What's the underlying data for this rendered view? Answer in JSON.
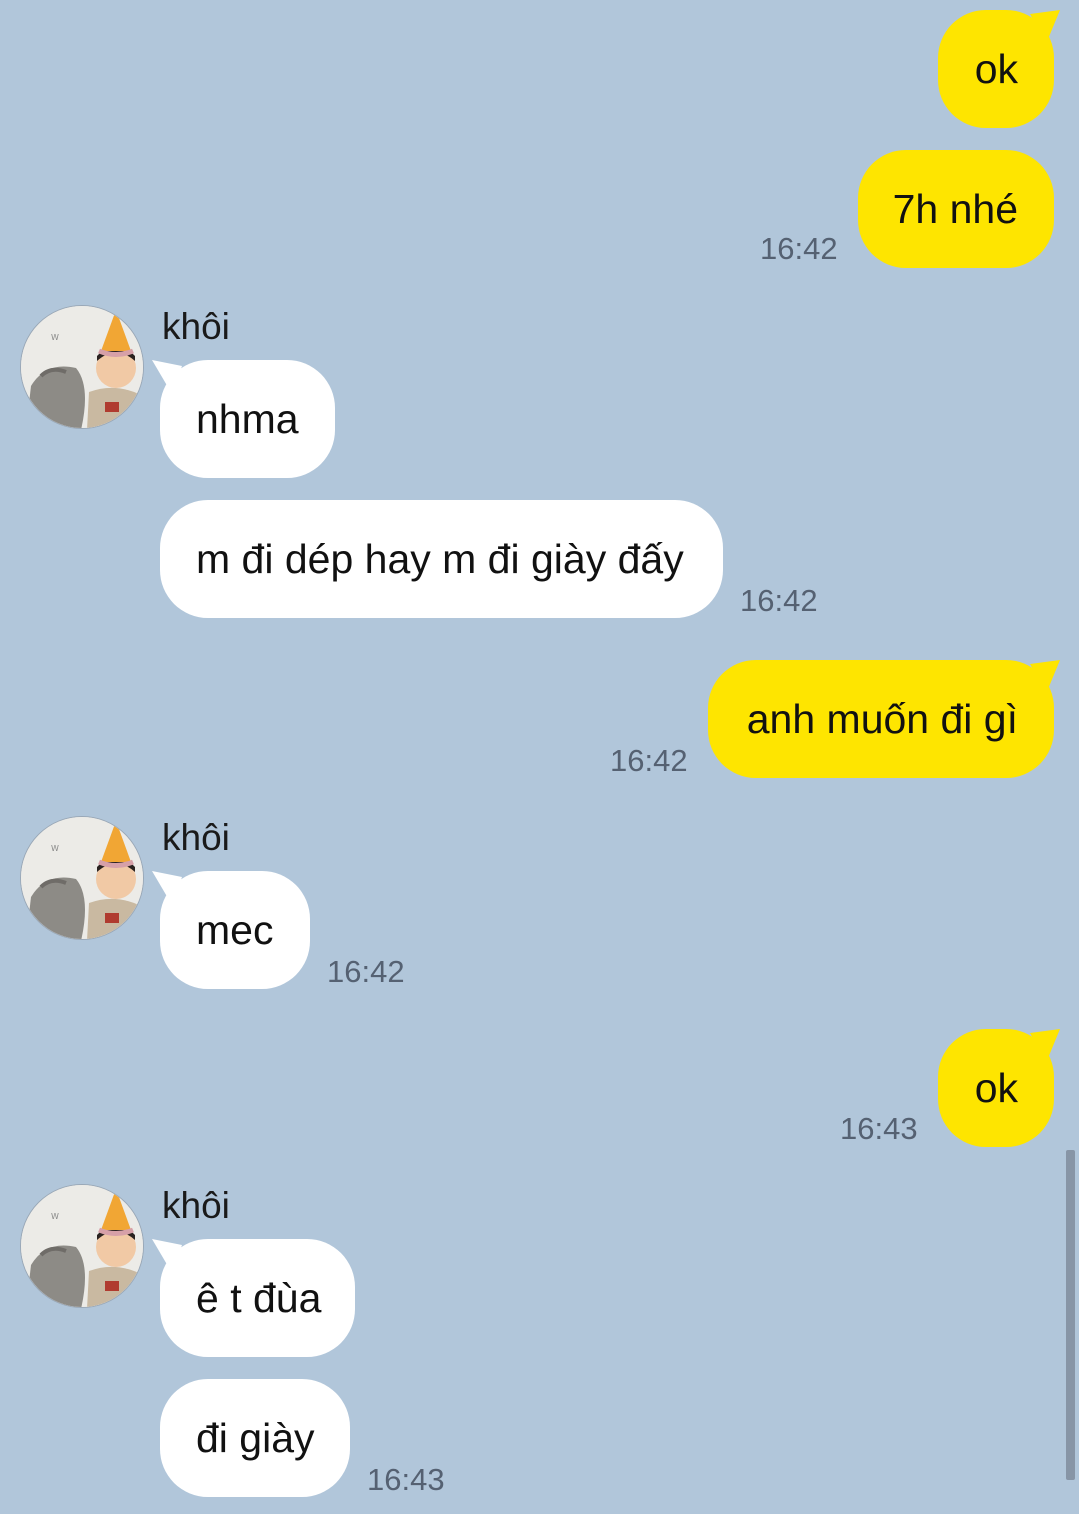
{
  "colors": {
    "background": "#b1c6da",
    "my_bubble": "#fee500",
    "their_bubble": "#ffffff",
    "timestamp": "#556172"
  },
  "contact": {
    "name": "khôi",
    "avatar_icon": "profile-photo-child-with-party-hat"
  },
  "messages": {
    "m1": {
      "text": "ok"
    },
    "m2": {
      "text": "7h nhé",
      "time": "16:42"
    },
    "m3": {
      "text": "nhma"
    },
    "m4": {
      "text": "m đi dép hay m đi giày đấy",
      "time": "16:42"
    },
    "m5": {
      "text": "anh muốn đi gì",
      "time": "16:42"
    },
    "m6": {
      "text": "mec",
      "time": "16:42"
    },
    "m7": {
      "text": "ok",
      "time": "16:43"
    },
    "m8": {
      "text": "ê t đùa"
    },
    "m9": {
      "text": "đi giày",
      "time": "16:43"
    }
  }
}
